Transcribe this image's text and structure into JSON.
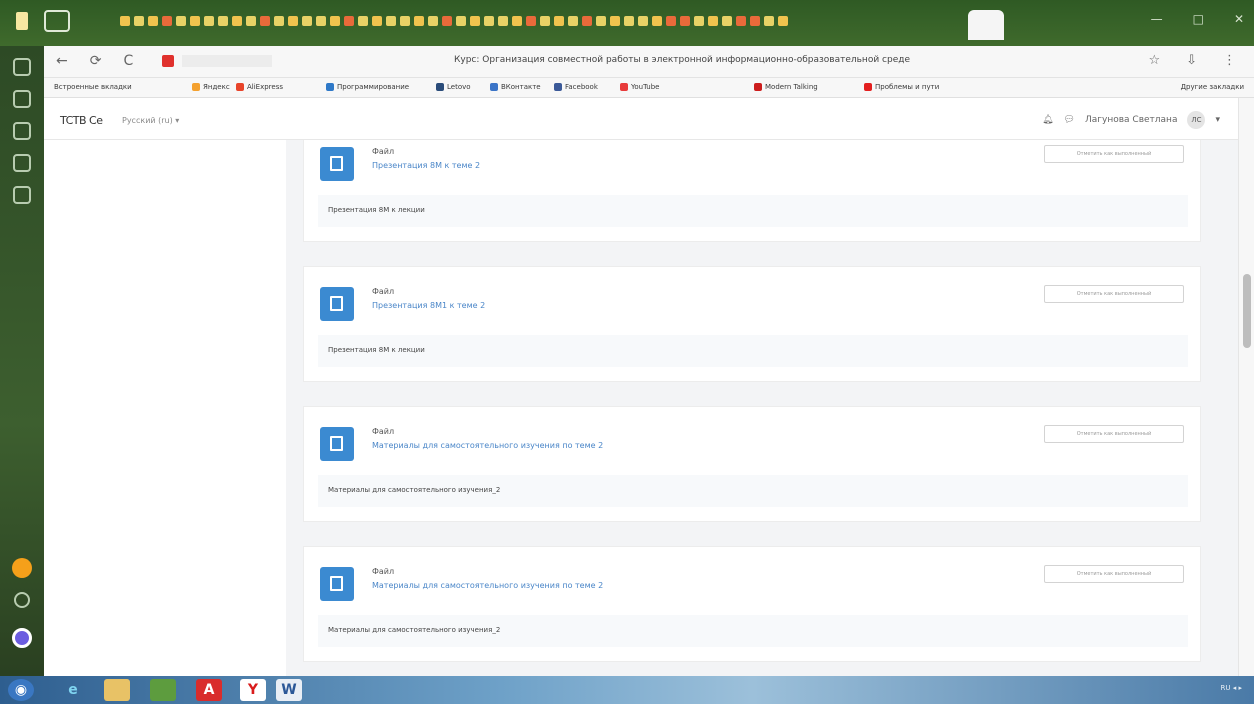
{
  "browser": {
    "tab_title": "Курс: Организация совместной работы в электронной информационно-образовательной среде",
    "toolbar_nav": [
      "←",
      "⟳",
      "C"
    ],
    "toolbar_right": [
      "☆",
      "⇩",
      "⋮"
    ],
    "bookmarks": [
      {
        "label": "Яндекс",
        "color": "#f4a12f"
      },
      {
        "label": "AliExpress",
        "color": "#e8442a"
      },
      {
        "label": "Программирование",
        "color": "#2f79c8"
      },
      {
        "label": "Letovo",
        "color": "#2a4c7a"
      },
      {
        "label": "ВКонтакте",
        "color": "#3b74c7"
      },
      {
        "label": "Facebook",
        "color": "#3b5998"
      },
      {
        "label": "YouTube",
        "color": "#e83b3b"
      },
      {
        "label": "Modern Talking",
        "color": "#cc1d1d"
      },
      {
        "label": "Проблемы и пути",
        "color": "#e31f1f"
      }
    ],
    "bookmarks_first": "Встроенные вкладки",
    "bookmarks_other": "Другие закладки"
  },
  "site": {
    "logo": "TCTB Ce",
    "language": "Русский (ru) ▾",
    "user": "Лагунова Светлана",
    "avatar": "ЛС"
  },
  "cards": [
    {
      "label": "Файл",
      "link": "Презентация 8М к теме 2",
      "desc": "Презентация 8М к лекции",
      "mark": "Отметить как выполненный"
    },
    {
      "label": "Файл",
      "link": "Презентация 8М1 к теме 2",
      "desc": "Презентация 8М к лекции",
      "mark": "Отметить как выполненный"
    },
    {
      "label": "Файл",
      "link": "Материалы для самостоятельного изучения по теме 2",
      "desc": "Материалы для самостоятельного изучения_2",
      "mark": "Отметить как выполненный"
    },
    {
      "label": "Файл",
      "link": "Материалы для самостоятельного изучения по теме 2",
      "desc": "Материалы для самостоятельного изучения_2",
      "mark": "Отметить как выполненный"
    }
  ],
  "taskbar": {
    "apps": [
      "start",
      "ie",
      "explorer",
      "media",
      "acrobat",
      "yandex",
      "word"
    ],
    "tray_text": "RU ◂ ▸"
  }
}
